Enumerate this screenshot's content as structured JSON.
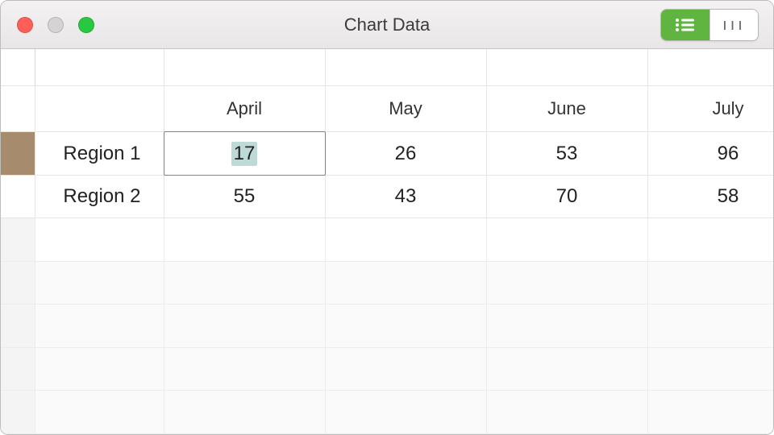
{
  "window": {
    "title": "Chart Data"
  },
  "view_toggle": {
    "list_active": true
  },
  "headers": {
    "col1": "April",
    "col2": "May",
    "col3": "June",
    "col4": "July"
  },
  "rows": [
    {
      "label": "Region 1",
      "c1": "17",
      "c2": "26",
      "c3": "53",
      "c4": "96"
    },
    {
      "label": "Region 2",
      "c1": "55",
      "c2": "43",
      "c3": "70",
      "c4": "58"
    }
  ],
  "selected": {
    "row": 0,
    "col": "c1"
  },
  "swatches": {
    "region1": "#a68c6d",
    "region2": "#5a554d"
  },
  "chart_data": {
    "type": "table",
    "categories": [
      "April",
      "May",
      "June",
      "July"
    ],
    "series": [
      {
        "name": "Region 1",
        "values": [
          17,
          26,
          53,
          96
        ]
      },
      {
        "name": "Region 2",
        "values": [
          55,
          43,
          70,
          58
        ]
      }
    ],
    "title": "Chart Data"
  }
}
